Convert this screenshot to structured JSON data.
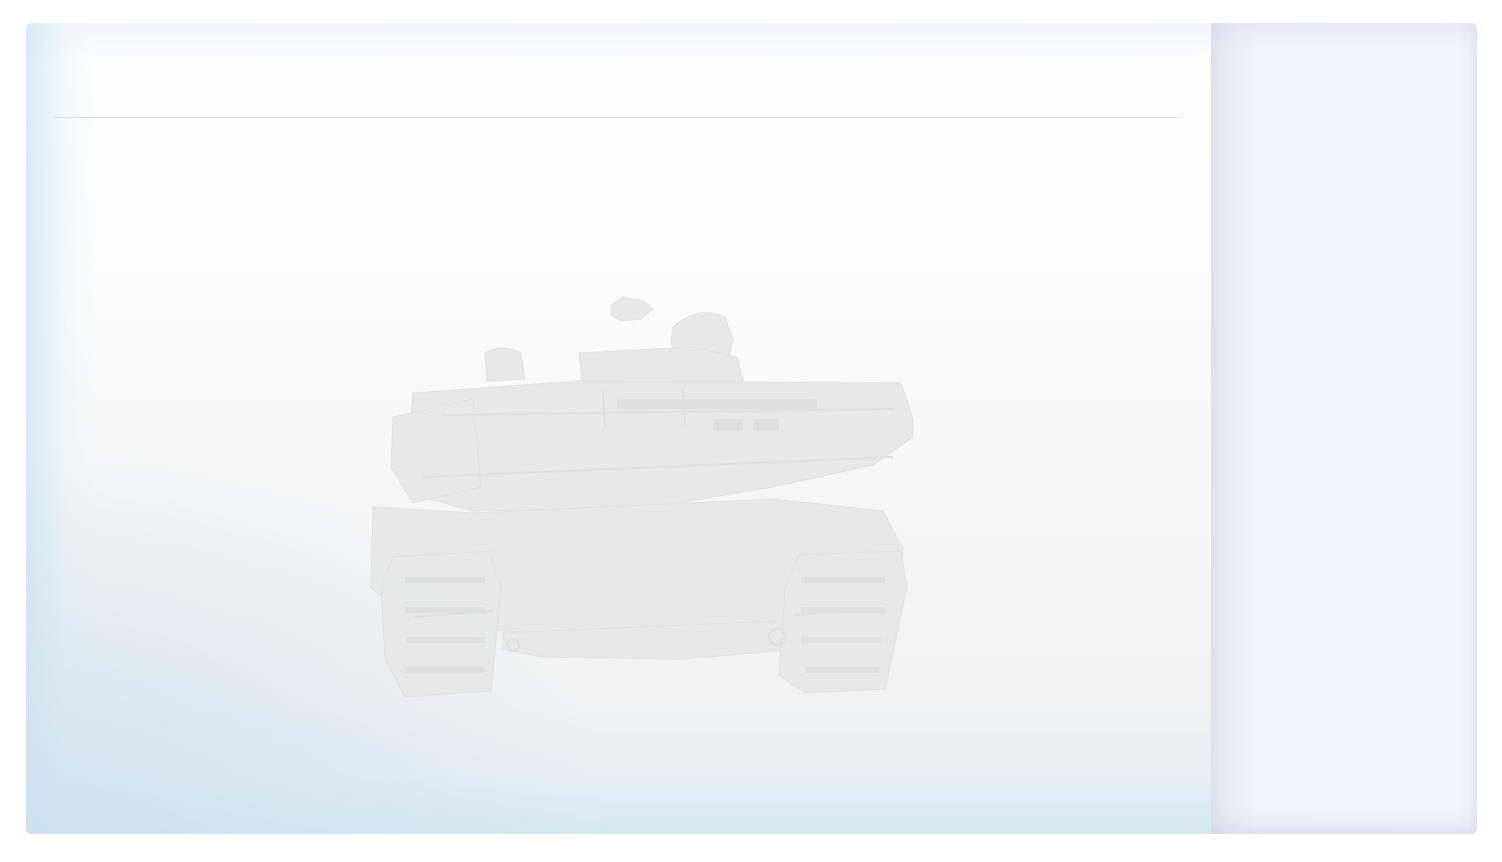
{
  "main_panel": {
    "header": {
      "title": ""
    },
    "background_image": {
      "icon": "tank-icon",
      "color": "#e6e6e6"
    }
  },
  "side_panel": {
    "color": "#f2f6fc"
  }
}
